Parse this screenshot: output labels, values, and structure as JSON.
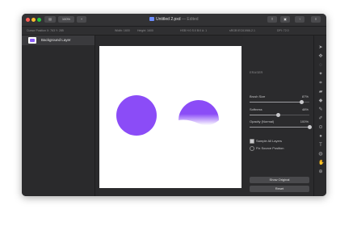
{
  "titlebar": {
    "zoom_label": "100%",
    "add_label": "+",
    "document_title": "Untitled 2.pxd",
    "edited_suffix": "— Edited",
    "right_icons": [
      "export-icon",
      "layers-toggle-icon",
      "share-icon",
      "more-icon"
    ]
  },
  "infobar": {
    "cursor_position": "Cursor Position X: 763  Y: 285",
    "width": "Width: 1600",
    "height": "Height: 1600",
    "color": "HSB H:0 S:0 B:0  A: 1",
    "color_space": "sRGB IEC61966-2.1",
    "dpi": "DPI: 72.0"
  },
  "layers": {
    "items": [
      {
        "label": "Background Layer"
      }
    ]
  },
  "panel": {
    "section_title": "ERASER",
    "brush_size": {
      "label": "Brush Size",
      "value": "87%",
      "level": 0.87
    },
    "softness": {
      "label": "Softness",
      "value": "48%",
      "level": 0.48
    },
    "opacity": {
      "label": "Opacity (Normal)",
      "value": "100%",
      "level": 1.0
    },
    "sample_all_layers": {
      "label": "Sample All Layers",
      "checked": true
    },
    "fix_source_position": {
      "label": "Fix Source Position",
      "checked": false
    },
    "show_original_label": "Show Original",
    "reset_label": "Reset"
  },
  "canvas": {
    "shape_color": "#8b4cf7",
    "background_color": "#ffffff"
  },
  "tools": [
    "arrow-icon",
    "move-icon",
    "lasso-icon",
    "magic-wand-icon",
    "crop-icon",
    "eraser-icon",
    "bucket-icon",
    "brush-icon",
    "pencil-icon",
    "clone-icon",
    "shape-icon",
    "text-icon",
    "blur-icon",
    "hand-icon",
    "zoom-icon"
  ]
}
